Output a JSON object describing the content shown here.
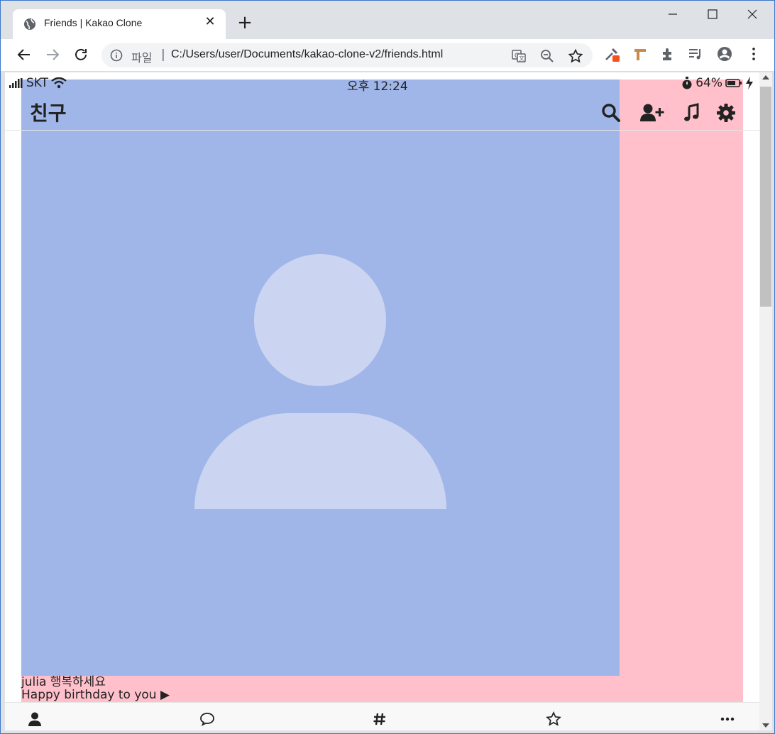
{
  "browser": {
    "tab_title": "Friends | Kakao Clone",
    "tab_close": "✕",
    "new_tab": "+",
    "omnibox": {
      "scheme_label": "파일",
      "separator": "|",
      "url": "C:/Users/user/Documents/kakao-clone-v2/friends.html"
    }
  },
  "status_bar": {
    "carrier": "SKT",
    "time": "오후 12:24",
    "battery": "64%"
  },
  "header": {
    "title": "친구"
  },
  "post": {
    "line1": "julia 행복하세요",
    "line2": "Happy birthday to you ▶"
  },
  "colors": {
    "photo_bg": "#a0b6e8",
    "page_bg": "#ffc0cb",
    "avatar_fill": "#cbd5f1"
  },
  "icons": {
    "header": [
      "search-icon",
      "add-friend-icon",
      "music-icon",
      "settings-icon"
    ],
    "tabbar": [
      "person-icon",
      "chat-icon",
      "hashtag-icon",
      "star-icon",
      "more-icon"
    ]
  }
}
